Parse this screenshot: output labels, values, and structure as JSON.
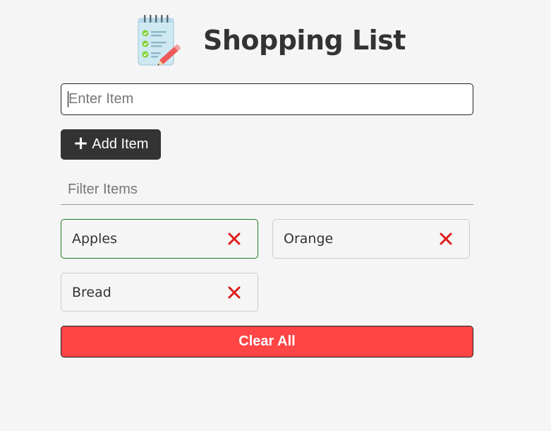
{
  "header": {
    "title": "Shopping List",
    "logo_icon": "checklist-notepad-icon"
  },
  "form": {
    "item_placeholder": "Enter Item",
    "item_value": "",
    "add_button_label": "Add Item",
    "add_button_icon": "plus-icon"
  },
  "filter": {
    "placeholder": "Filter Items",
    "value": ""
  },
  "items": [
    {
      "label": "Apples",
      "remove_icon": "x-mark-icon",
      "highlighted": true
    },
    {
      "label": "Orange",
      "remove_icon": "x-mark-icon",
      "highlighted": false
    },
    {
      "label": "Bread",
      "remove_icon": "x-mark-icon",
      "highlighted": false
    }
  ],
  "clear_button_label": "Clear All",
  "colors": {
    "background": "#f5f5f5",
    "text": "#333333",
    "add_button": "#333333",
    "clear_button": "#ff4546",
    "remove_icon": "#e01b1b",
    "highlight_border": "#1d7a1d"
  }
}
